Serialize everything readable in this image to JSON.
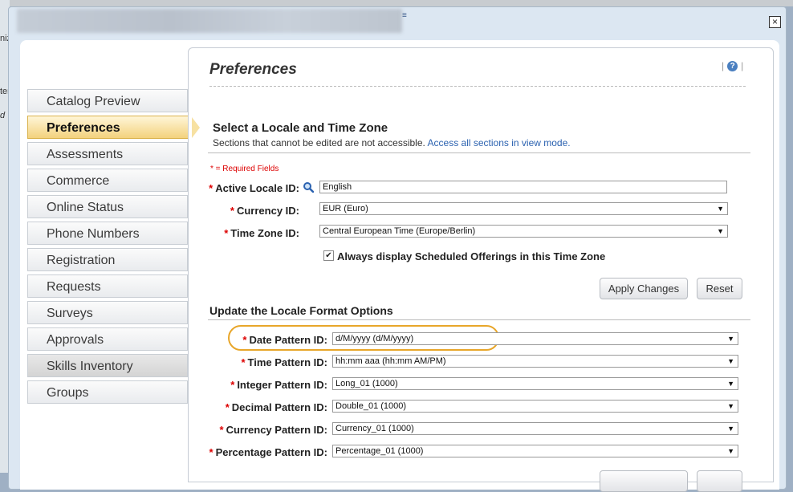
{
  "dialog": {
    "close_label": "×"
  },
  "background": {
    "fragments": [
      "nizi",
      "ter",
      "d"
    ]
  },
  "panel": {
    "title": "Preferences",
    "help_label": "?"
  },
  "nav": {
    "items": [
      {
        "label": "Catalog Preview"
      },
      {
        "label": "Preferences"
      },
      {
        "label": "Assessments"
      },
      {
        "label": "Commerce"
      },
      {
        "label": "Online Status"
      },
      {
        "label": "Phone Numbers"
      },
      {
        "label": "Registration"
      },
      {
        "label": "Requests"
      },
      {
        "label": "Surveys"
      },
      {
        "label": "Approvals"
      },
      {
        "label": "Skills Inventory"
      },
      {
        "label": "Groups"
      }
    ]
  },
  "locale_section": {
    "title": "Select a Locale and Time Zone",
    "subtitle": "Sections that cannot be edited are not accessible.",
    "subtitle_link": "Access all sections in view mode.",
    "required_note": "* = Required Fields",
    "active_locale_label": "Active Locale ID:",
    "active_locale_value": "English",
    "currency_label": "Currency ID:",
    "currency_value": "EUR (Euro)",
    "timezone_label": "Time Zone ID:",
    "timezone_value": "Central European Time (Europe/Berlin)",
    "always_display_label": "Always display Scheduled Offerings in this Time Zone",
    "always_display_checked": true,
    "apply_label": "Apply Changes",
    "reset_label": "Reset"
  },
  "format_section": {
    "title": "Update the Locale Format Options",
    "date_label": "Date Pattern ID:",
    "date_value": "d/M/yyyy (d/M/yyyy)",
    "time_label": "Time Pattern ID:",
    "time_value": "hh:mm aaa (hh:mm AM/PM)",
    "integer_label": "Integer Pattern ID:",
    "integer_value": "Long_01 (1000)",
    "decimal_label": "Decimal Pattern ID:",
    "decimal_value": "Double_01 (1000)",
    "currency_pattern_label": "Currency Pattern ID:",
    "currency_pattern_value": "Currency_01 (1000)",
    "percentage_label": "Percentage Pattern ID:",
    "percentage_value": "Percentage_01 (1000)"
  },
  "icons": {
    "search": "search-icon",
    "help": "help-icon",
    "close": "close-icon",
    "dropdown": "chevron-down-icon"
  },
  "colors": {
    "accent_link": "#2b62b0",
    "required": "#dd0000",
    "active_tab": "#f3d27d",
    "highlight_ring": "#e8a62a"
  }
}
